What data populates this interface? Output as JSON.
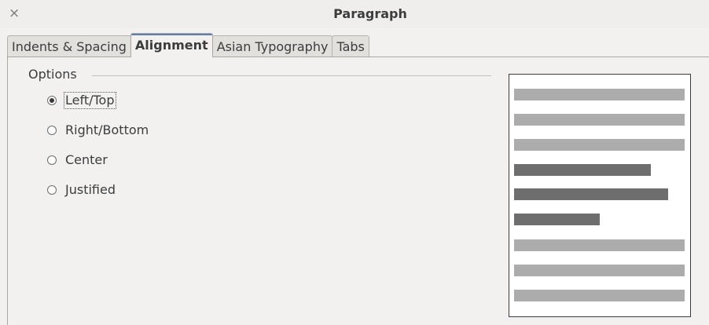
{
  "dialog": {
    "title": "Paragraph",
    "close_glyph": "×"
  },
  "tabs": [
    {
      "label": "Indents & Spacing",
      "active": false
    },
    {
      "label": "Alignment",
      "active": true
    },
    {
      "label": "Asian Typography",
      "active": false
    },
    {
      "label": "Tabs",
      "active": false
    }
  ],
  "options": {
    "group_label": "Options",
    "radios": [
      {
        "label": "Left/Top",
        "checked": true
      },
      {
        "label": "Right/Bottom",
        "checked": false
      },
      {
        "label": "Center",
        "checked": false
      },
      {
        "label": "Justified",
        "checked": false
      }
    ]
  },
  "preview": {
    "colors": {
      "context_line": "#acacac",
      "paragraph_line": "#6e6e6e"
    }
  }
}
